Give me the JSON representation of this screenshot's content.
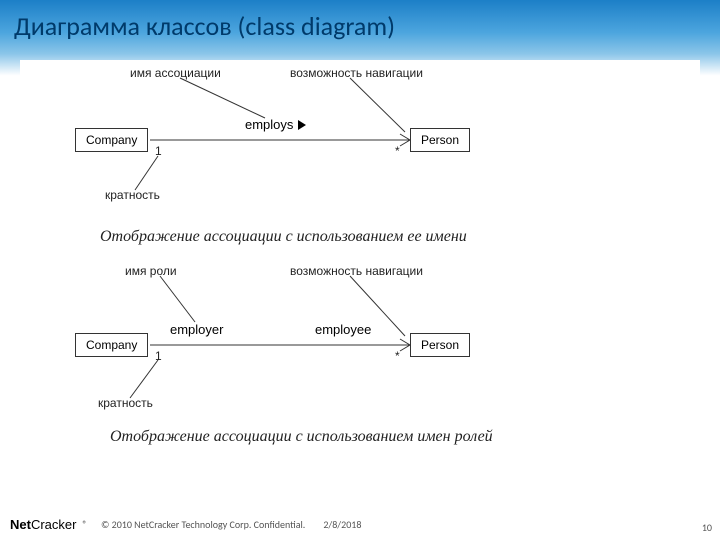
{
  "title": "Диаграмма классов (class diagram)",
  "diagram1": {
    "labels": {
      "assoc_name_ptr": "имя ассоциации",
      "navigability_ptr": "возможность навигации",
      "multiplicity_ptr": "кратность",
      "assoc_label": "employs",
      "mult_left": "1",
      "mult_right": "*"
    },
    "class_left": "Company",
    "class_right": "Person",
    "caption": "Отображение ассоциации с использованием ее имени"
  },
  "diagram2": {
    "labels": {
      "role_name_ptr": "имя роли",
      "navigability_ptr": "возможность навигации",
      "multiplicity_ptr": "кратность",
      "role_left": "employer",
      "role_right": "employee",
      "mult_left": "1",
      "mult_right": "*"
    },
    "class_left": "Company",
    "class_right": "Person",
    "caption": "Отображение ассоциации с использованием имен ролей"
  },
  "footer": {
    "logo_a": "Net",
    "logo_b": "Cracker",
    "reg": "®",
    "copyright": "© 2010 NetCracker Technology Corp. Confidential.",
    "date": "2/8/2018",
    "page": "10"
  }
}
